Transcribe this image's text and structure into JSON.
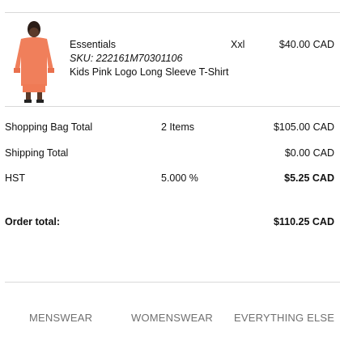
{
  "cart_item": {
    "brand": "Essentials",
    "sku": "SKU: 222161M70301106",
    "name": "Kids Pink Logo Long Sleeve T-Shirt",
    "size": "Xxl",
    "price": "$40.00 CAD",
    "image_color": "#f07f5b"
  },
  "summary": {
    "bag_total_label": "Shopping Bag Total",
    "bag_total_count": "2 Items",
    "bag_total_value": "$105.00 CAD",
    "shipping_label": "Shipping Total",
    "shipping_value": "$0.00 CAD",
    "tax_label": "HST",
    "tax_rate": "5.000 %",
    "tax_value": "$5.25 CAD",
    "order_total_label": "Order total:",
    "order_total_value": "$110.25 CAD"
  },
  "footer_nav": [
    "MENSWEAR",
    "WOMENSWEAR",
    "EVERYTHING ELSE"
  ]
}
